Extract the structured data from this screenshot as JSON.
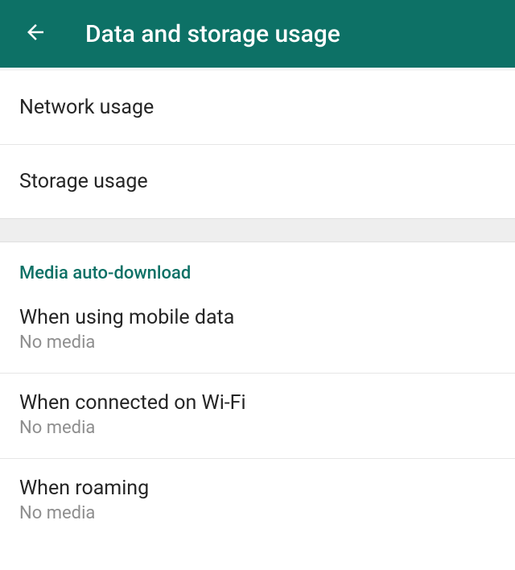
{
  "header": {
    "title": "Data and storage usage"
  },
  "usageSection": {
    "items": [
      {
        "title": "Network usage"
      },
      {
        "title": "Storage usage"
      }
    ]
  },
  "mediaSection": {
    "heading": "Media auto-download",
    "items": [
      {
        "title": "When using mobile data",
        "subtitle": "No media"
      },
      {
        "title": "When connected on Wi-Fi",
        "subtitle": "No media"
      },
      {
        "title": "When roaming",
        "subtitle": "No media"
      }
    ]
  }
}
